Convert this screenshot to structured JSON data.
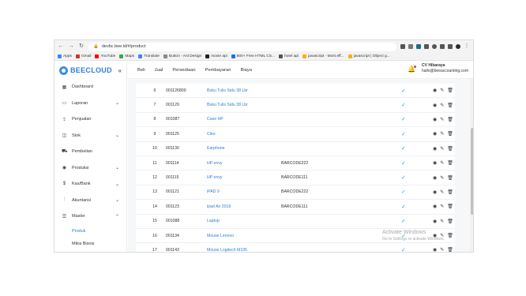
{
  "browser": {
    "url": "devbc.bee.id/#/product",
    "bookmarks": [
      "Apps",
      "Gmail",
      "YouTube",
      "Maps",
      "Translate",
      "Button - Ant Design",
      "movie api",
      "500+ Free HTML CS...",
      "hotel api",
      "javascript - Most eff...",
      "javascript | Object g..."
    ],
    "bookmark_colors": [
      "#4285f4",
      "#d93025",
      "#ff0000",
      "#34a853",
      "#4285f4",
      "#888888",
      "#222222",
      "#1a73e8",
      "#555555",
      "#f4b400",
      "#f4b400"
    ]
  },
  "app": {
    "logo": "BEECLOUD",
    "accent": "#2f7fd6",
    "topnav": [
      "Beli",
      "Jual",
      "Persediaan",
      "Pembayaran",
      "Biaya"
    ],
    "user": {
      "name": "CV Hibaraya",
      "email": "hallo@beeaccounting.com"
    }
  },
  "sidebar": {
    "items": [
      {
        "label": "Dashboard",
        "icon": "dashboard-icon"
      },
      {
        "label": "Laporan",
        "icon": "monitor-icon",
        "caret": "⌄"
      },
      {
        "label": "Penjualan",
        "icon": "upload-icon"
      },
      {
        "label": "Stok",
        "icon": "box-icon",
        "caret": "⌄"
      },
      {
        "label": "Pembelian",
        "icon": "cart-icon"
      },
      {
        "label": "Produksi",
        "icon": "production-icon",
        "caret": "⌄"
      },
      {
        "label": "Kas/Bank",
        "icon": "dollar-icon",
        "caret": "⌄"
      },
      {
        "label": "Akuntansi",
        "icon": "chart-icon",
        "caret": "⌄"
      },
      {
        "label": "Master",
        "icon": "database-icon",
        "caret": "⌃"
      }
    ],
    "submenu": [
      {
        "label": "Produk",
        "active": true
      },
      {
        "label": "Mitra Bisnis",
        "active": false
      }
    ]
  },
  "table": {
    "rows": [
      {
        "no": "6",
        "code": "001126800",
        "name": "Buku Tulis Sidu 38 Lbr",
        "barcode": ""
      },
      {
        "no": "7",
        "code": "001129",
        "name": "Buku Tulis Sidu 38 Lbr",
        "barcode": ""
      },
      {
        "no": "8",
        "code": "001087",
        "name": "Case HP",
        "barcode": ""
      },
      {
        "no": "9",
        "code": "001125",
        "name": "Cleo",
        "barcode": ""
      },
      {
        "no": "10",
        "code": "001130",
        "name": "Earphone",
        "barcode": ""
      },
      {
        "no": "11",
        "code": "001114",
        "name": "HP envy",
        "barcode": "BARCODE222"
      },
      {
        "no": "12",
        "code": "001115",
        "name": "HP envy",
        "barcode": "BARCODE111"
      },
      {
        "no": "13",
        "code": "001121",
        "name": "iPAD 9",
        "barcode": "BARCODE222"
      },
      {
        "no": "14",
        "code": "001123",
        "name": "ipad Air 2019",
        "barcode": "BARCODE111"
      },
      {
        "no": "15",
        "code": "001088",
        "name": "Laptop",
        "barcode": ""
      },
      {
        "no": "16",
        "code": "001134",
        "name": "Mouse Lenovo",
        "barcode": ""
      },
      {
        "no": "17",
        "code": "001143",
        "name": "Mouse Logitech M195",
        "barcode": ""
      }
    ]
  },
  "watermark": {
    "title": "Activate Windows",
    "subtitle": "Go to Settings to activate Windows."
  }
}
